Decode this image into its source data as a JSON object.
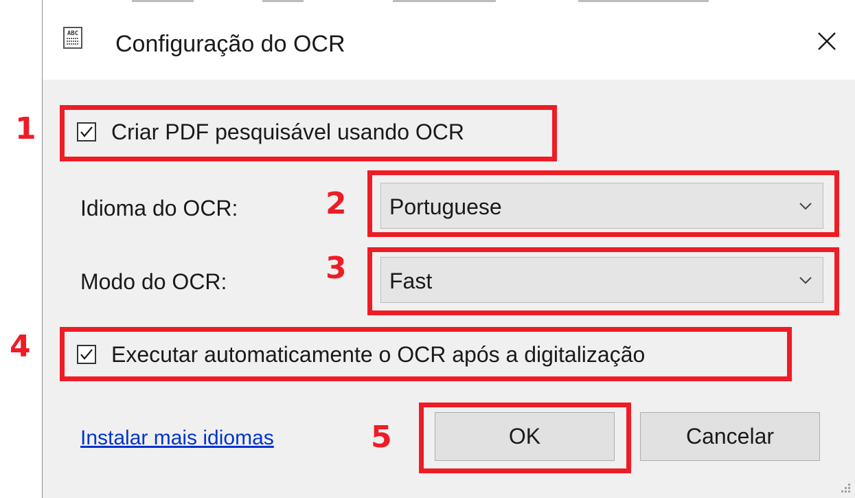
{
  "window": {
    "title": "Configuração do OCR",
    "icon": "abc-text-document-icon",
    "close_icon": "close-x-icon"
  },
  "searchable_pdf": {
    "label": "Criar PDF pesquisável usando OCR",
    "checked": true
  },
  "language": {
    "label": "Idioma do OCR:",
    "value": "Portuguese"
  },
  "mode": {
    "label": "Modo do OCR:",
    "value": "Fast"
  },
  "auto_run": {
    "label": "Executar automaticamente o OCR após a digitalização",
    "checked": true
  },
  "install_link": "Instalar mais idiomas",
  "buttons": {
    "ok": "OK",
    "cancel": "Cancelar"
  },
  "annotations": {
    "n1": "1",
    "n2": "2",
    "n3": "3",
    "n4": "4",
    "n5": "5",
    "color": "#ee1c25"
  }
}
